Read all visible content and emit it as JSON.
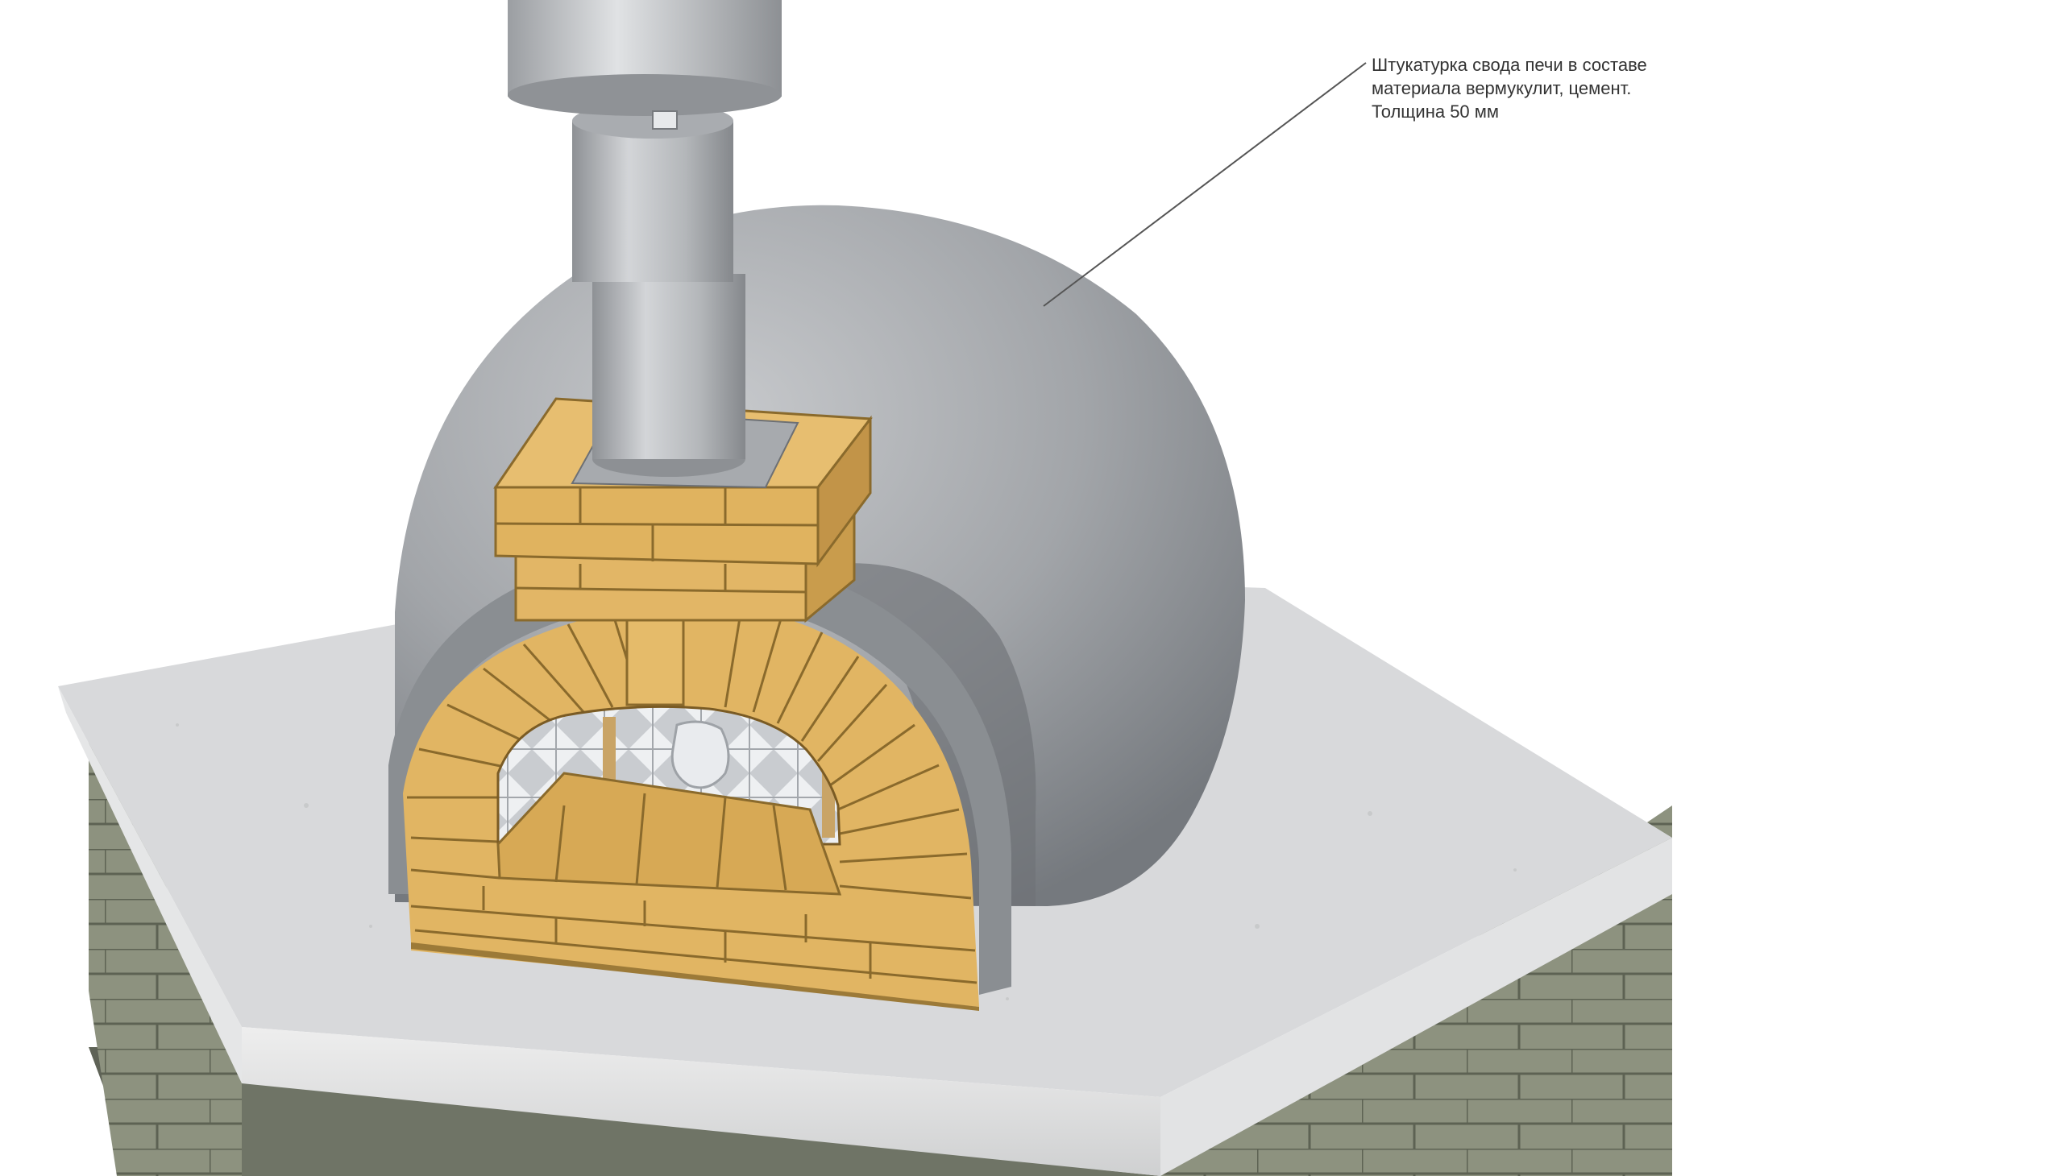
{
  "annotation": {
    "lines": [
      "Штукатурка свода печи в составе",
      "материала вермукулит, цемент.",
      "Толщина 50 мм"
    ]
  },
  "colors": {
    "background": "#ffffff",
    "dome_plaster": "#9a9da1",
    "slab_concrete": "#d9dadb",
    "brick": "#e0b461",
    "brick_mortar": "#8a6a2c",
    "flue_pipe": "#b8babd",
    "base_block": "#8f9484",
    "leader_line": "#555555"
  }
}
